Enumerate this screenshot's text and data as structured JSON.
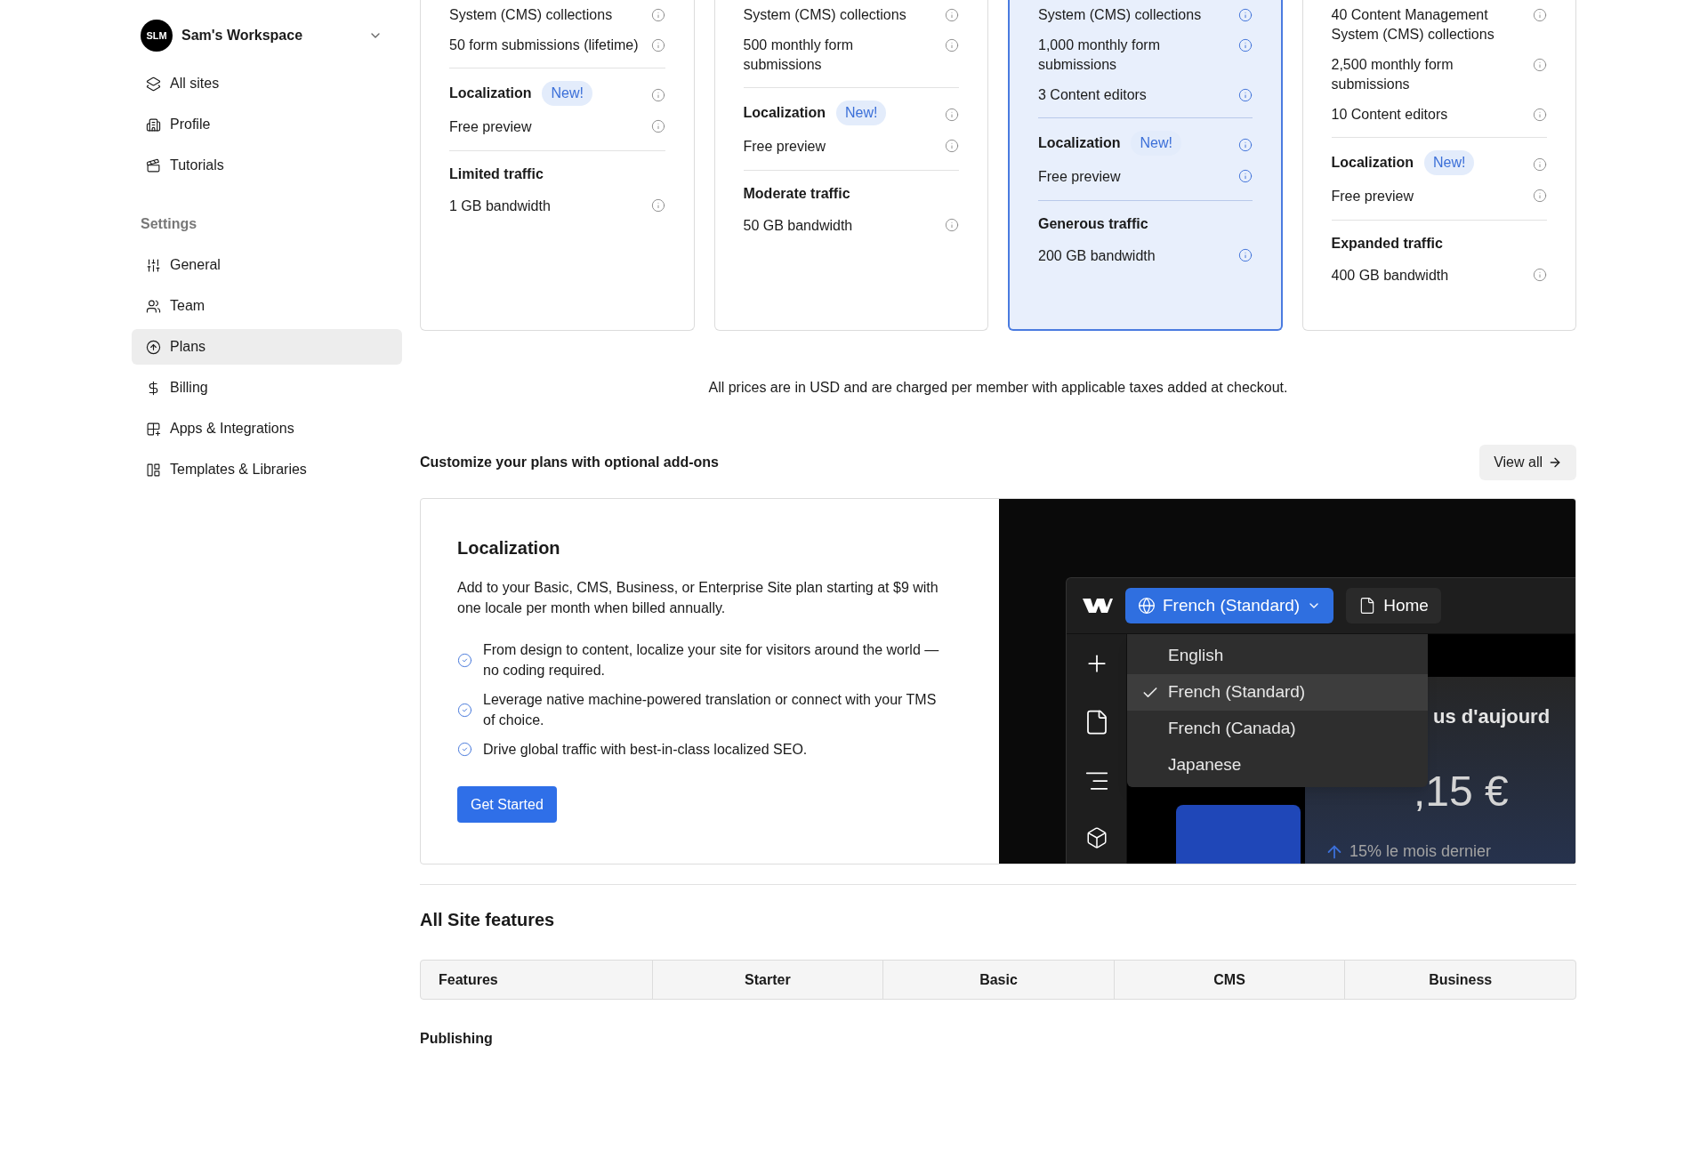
{
  "sidebar": {
    "workspace": {
      "avatar": "SLM",
      "name": "Sam's Workspace"
    },
    "items": [
      {
        "label": "All sites",
        "selected": false
      },
      {
        "label": "Profile",
        "selected": false
      },
      {
        "label": "Tutorials",
        "selected": false
      }
    ],
    "settings_heading": "Settings",
    "settings_items": [
      {
        "label": "General",
        "selected": false
      },
      {
        "label": "Team",
        "selected": false
      },
      {
        "label": "Plans",
        "selected": true
      },
      {
        "label": "Billing",
        "selected": false
      },
      {
        "label": "Apps & Integrations",
        "selected": false
      },
      {
        "label": "Templates & Libraries",
        "selected": false
      }
    ]
  },
  "plans": [
    {
      "selected": false,
      "features": [
        "System (CMS) collections",
        "50 form submissions (lifetime)"
      ],
      "localization": {
        "label": "Localization",
        "badge": "New!",
        "detail": "Free preview"
      },
      "traffic": {
        "title": "Limited traffic",
        "detail": "1 GB bandwidth"
      }
    },
    {
      "selected": false,
      "features": [
        "System (CMS) collections",
        "500 monthly form submissions"
      ],
      "localization": {
        "label": "Localization",
        "badge": "New!",
        "detail": "Free preview"
      },
      "traffic": {
        "title": "Moderate traffic",
        "detail": "50 GB bandwidth"
      }
    },
    {
      "selected": true,
      "features": [
        "System (CMS) collections",
        "1,000 monthly form submissions",
        "3 Content editors"
      ],
      "localization": {
        "label": "Localization",
        "badge": "New!",
        "detail": "Free preview"
      },
      "traffic": {
        "title": "Generous traffic",
        "detail": "200 GB bandwidth"
      }
    },
    {
      "selected": false,
      "features": [
        "40 Content Management System (CMS) collections",
        "2,500 monthly form submissions",
        "10 Content editors"
      ],
      "localization": {
        "label": "Localization",
        "badge": "New!",
        "detail": "Free preview"
      },
      "traffic": {
        "title": "Expanded traffic",
        "detail": "400 GB bandwidth"
      }
    }
  ],
  "pricing_note": "All prices are in USD and are charged per member with applicable taxes added at checkout.",
  "addons": {
    "heading": "Customize your plans with optional add-ons",
    "view_all": "View all",
    "card": {
      "title": "Localization",
      "description": "Add to your Basic, CMS, Business, or Enterprise Site plan starting at $9 with one locale per month when billed annually.",
      "bullets": [
        "From design to content, localize your site for visitors around the world —no coding required.",
        "Leverage native machine-powered translation or connect with your TMS of choice.",
        "Drive global traffic with best-in-class localized SEO."
      ],
      "button": "Get Started"
    },
    "preview": {
      "language_button": "French (Standard)",
      "page_button": "Home",
      "languages": [
        {
          "label": "English",
          "selected": false
        },
        {
          "label": "French (Standard)",
          "selected": true
        },
        {
          "label": "French (Canada)",
          "selected": false
        },
        {
          "label": "Japanese",
          "selected": false
        }
      ],
      "heading": "us d'aujourd",
      "amount": ",15 €",
      "change": "15% le mois dernier"
    }
  },
  "features_section": {
    "heading": "All Site features",
    "columns": [
      "Features",
      "Starter",
      "Basic",
      "CMS",
      "Business"
    ],
    "group": "Publishing"
  }
}
